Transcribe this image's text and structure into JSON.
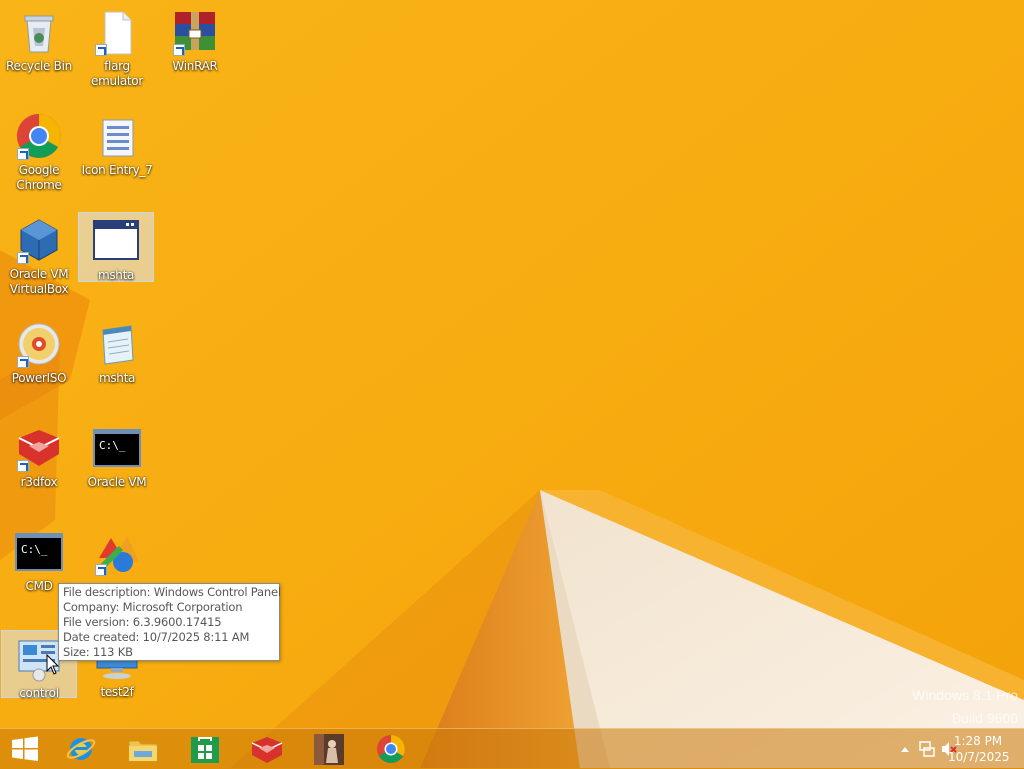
{
  "desktop": {
    "icons": [
      {
        "label": "Recycle Bin",
        "icon": "recycle-bin-icon"
      },
      {
        "label": "flarg emulator",
        "icon": "blank-file-icon"
      },
      {
        "label": "WinRAR",
        "icon": "winrar-icon"
      },
      {
        "label": "Google Chrome",
        "icon": "chrome-icon"
      },
      {
        "label": "Icon Entry_7",
        "icon": "form-document-icon"
      },
      {
        "label": "Oracle VM VirtualBox",
        "icon": "virtualbox-icon"
      },
      {
        "label": "mshta",
        "icon": "application-window-icon"
      },
      {
        "label": "PowerISO",
        "icon": "disc-icon"
      },
      {
        "label": "mshta",
        "icon": "notepad-icon"
      },
      {
        "label": "r3dfox",
        "icon": "r3dfox-icon"
      },
      {
        "label": "Oracle VM",
        "icon": "command-prompt-icon"
      },
      {
        "label": "CMD",
        "icon": "command-prompt-icon"
      },
      {
        "label": "control",
        "icon": "control-panel-icon"
      },
      {
        "label": "test2f",
        "icon": "computer-icon"
      }
    ]
  },
  "tooltip": {
    "description": "File description: Windows Control Panel",
    "company": "Company: Microsoft Corporation",
    "version": "File version: 6.3.9600.17415",
    "created": "Date created: 10/7/2025 8:11 AM",
    "size": "Size: 113 KB"
  },
  "watermark": {
    "line1": "Windows 8.1 Pro",
    "line2": "Build 9600"
  },
  "taskbar": {
    "buttons": [
      {
        "icon": "windows-start-icon"
      },
      {
        "icon": "internet-explorer-icon"
      },
      {
        "icon": "file-explorer-icon"
      },
      {
        "icon": "windows-store-icon"
      },
      {
        "icon": "r3dfox-icon"
      },
      {
        "icon": "app-thumbnail-icon"
      },
      {
        "icon": "chrome-icon"
      }
    ],
    "clock": {
      "time": "1:28 PM",
      "date": "10/7/2025"
    },
    "tray_icons": [
      "show-hidden-icons-chevron",
      "network-icon",
      "volume-muted-icon"
    ]
  },
  "colors": {
    "wallpaper_base": "#f7a90c",
    "wallpaper_light": "#fdbd2a",
    "wallpaper_dark": "#e9850e",
    "paper_white": "#f3e6d2"
  }
}
